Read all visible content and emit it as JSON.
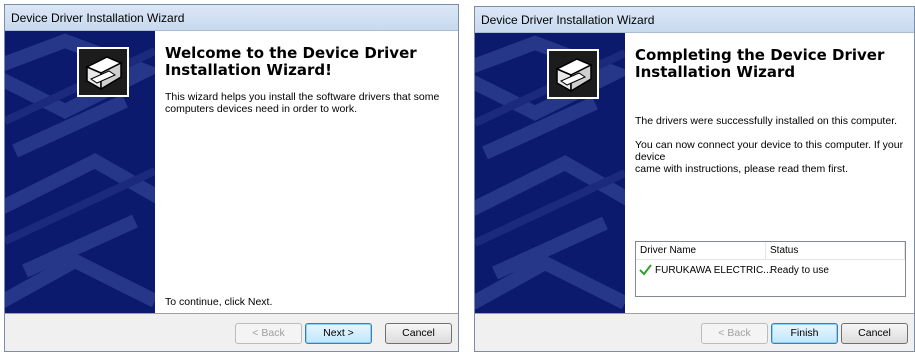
{
  "colors": {
    "panel": "#0b1a6c",
    "accent": "#3c7fb1",
    "check": "#2fa12f"
  },
  "welcome": {
    "window_title": "Device Driver Installation Wizard",
    "heading_line1": "Welcome to the Device Driver",
    "heading_line2": "Installation Wizard!",
    "description_line1": "This wizard helps you install the software drivers that some",
    "description_line2": "computers devices need in order to work.",
    "continue_text": "To continue, click Next.",
    "back_label": "< Back",
    "next_label": "Next >",
    "cancel_label": "Cancel"
  },
  "complete": {
    "window_title": "Device Driver Installation Wizard",
    "heading_line1": "Completing the Device Driver",
    "heading_line2": "Installation Wizard",
    "success_text": "The drivers were successfully installed on this computer.",
    "instructions_line1": "You can now connect your device to this computer. If your device",
    "instructions_line2": "came with instructions, please read them first.",
    "table": {
      "col_name": "Driver Name",
      "col_status": "Status",
      "rows": [
        {
          "name": "FURUKAWA ELECTRIC...",
          "status": "Ready to use"
        }
      ]
    },
    "back_label": "< Back",
    "finish_label": "Finish",
    "cancel_label": "Cancel"
  },
  "icons": {
    "wizard": "device-install-icon",
    "check": "checkmark-icon"
  }
}
